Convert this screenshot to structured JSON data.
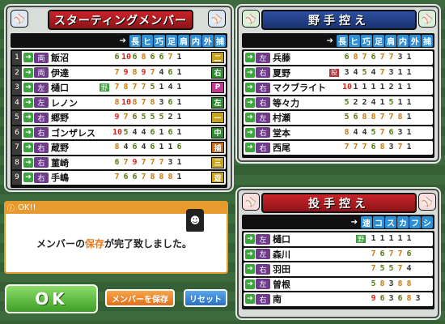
{
  "starting": {
    "title": "スターティングメンバー",
    "headers": [
      "長",
      "ヒ",
      "巧",
      "足",
      "肩",
      "内",
      "外",
      "捕"
    ],
    "rows": [
      {
        "n": "1",
        "hand": "両",
        "name": "飯沼",
        "stats": [
          "6",
          "10",
          "6",
          "8",
          "6",
          "6",
          "7",
          "1"
        ],
        "pos": "二"
      },
      {
        "n": "2",
        "hand": "両",
        "name": "伊達",
        "stats": [
          "7",
          "9",
          "8",
          "9",
          "7",
          "4",
          "6",
          "1"
        ],
        "pos": "右"
      },
      {
        "n": "3",
        "hand": "左",
        "name": "樋口",
        "tag": "野",
        "stats": [
          "7",
          "8",
          "7",
          "7",
          "5",
          "1",
          "4",
          "1"
        ],
        "pos": "P"
      },
      {
        "n": "4",
        "hand": "左",
        "name": "レノン",
        "stats": [
          "8",
          "10",
          "8",
          "7",
          "8",
          "3",
          "6",
          "1"
        ],
        "pos": "左"
      },
      {
        "n": "5",
        "hand": "右",
        "name": "郷野",
        "stats": [
          "9",
          "7",
          "6",
          "5",
          "5",
          "5",
          "2",
          "1"
        ],
        "pos": "一"
      },
      {
        "n": "6",
        "hand": "右",
        "name": "ゴンザレス",
        "stats": [
          "10",
          "5",
          "4",
          "4",
          "6",
          "1",
          "6",
          "1"
        ],
        "pos": "中"
      },
      {
        "n": "7",
        "hand": "右",
        "name": "蔵野",
        "stats": [
          "8",
          "4",
          "6",
          "4",
          "6",
          "1",
          "1",
          "6"
        ],
        "pos": "捕"
      },
      {
        "n": "8",
        "hand": "右",
        "name": "菫崎",
        "stats": [
          "6",
          "7",
          "9",
          "7",
          "7",
          "7",
          "3",
          "1"
        ],
        "pos": "三"
      },
      {
        "n": "9",
        "hand": "右",
        "name": "手嶋",
        "stats": [
          "7",
          "6",
          "6",
          "7",
          "8",
          "8",
          "8",
          "1"
        ],
        "pos": "遊"
      }
    ]
  },
  "bench": {
    "title": "野手控え",
    "headers": [
      "長",
      "ヒ",
      "巧",
      "足",
      "肩",
      "内",
      "外",
      "捕"
    ],
    "rows": [
      {
        "hand": "左",
        "name": "兵藤",
        "stats": [
          "6",
          "8",
          "7",
          "6",
          "7",
          "7",
          "3",
          "1"
        ]
      },
      {
        "hand": "右",
        "name": "夏野",
        "tag": "投",
        "stats": [
          "3",
          "4",
          "5",
          "4",
          "7",
          "3",
          "1",
          "1"
        ]
      },
      {
        "hand": "右",
        "name": "マクブライト",
        "stats": [
          "10",
          "1",
          "1",
          "1",
          "1",
          "2",
          "1",
          "1"
        ]
      },
      {
        "hand": "右",
        "name": "等々力",
        "stats": [
          "5",
          "2",
          "2",
          "4",
          "1",
          "5",
          "1",
          "1"
        ]
      },
      {
        "hand": "左",
        "name": "村瀬",
        "stats": [
          "5",
          "6",
          "8",
          "8",
          "7",
          "7",
          "8",
          "1"
        ]
      },
      {
        "hand": "右",
        "name": "堂本",
        "stats": [
          "8",
          "4",
          "4",
          "5",
          "7",
          "6",
          "3",
          "1"
        ]
      },
      {
        "hand": "右",
        "name": "西尾",
        "stats": [
          "7",
          "7",
          "7",
          "6",
          "8",
          "3",
          "7",
          "1"
        ]
      }
    ]
  },
  "pitchers": {
    "title": "投手控え",
    "headers": [
      "速",
      "コ",
      "ス",
      "カ",
      "フ",
      "シ"
    ],
    "rows": [
      {
        "hand": "左",
        "name": "樋口",
        "tag": "野",
        "stats": [
          "1",
          "1",
          "1",
          "1",
          "1"
        ]
      },
      {
        "hand": "左",
        "name": "森川",
        "stats": [
          "7",
          "6",
          "7",
          "7",
          "6"
        ]
      },
      {
        "hand": "右",
        "name": "羽田",
        "stats": [
          "7",
          "5",
          "5",
          "7",
          "4"
        ]
      },
      {
        "hand": "左",
        "name": "曽根",
        "stats": [
          "5",
          "8",
          "3",
          "8",
          "8"
        ]
      },
      {
        "hand": "右",
        "name": "南",
        "stats": [
          "9",
          "6",
          "3",
          "6",
          "8",
          "3"
        ]
      }
    ]
  },
  "message": {
    "header": "OK!!",
    "pre": "メンバーの",
    "highlight": "保存",
    "post": "が完了致しました。"
  },
  "buttons": {
    "ok": "OK",
    "save": "メンバーを保存",
    "reset": "リセット"
  },
  "colors": {
    "red": "#c8242a",
    "blue": "#1a3270",
    "accent": "#e79a2d"
  }
}
